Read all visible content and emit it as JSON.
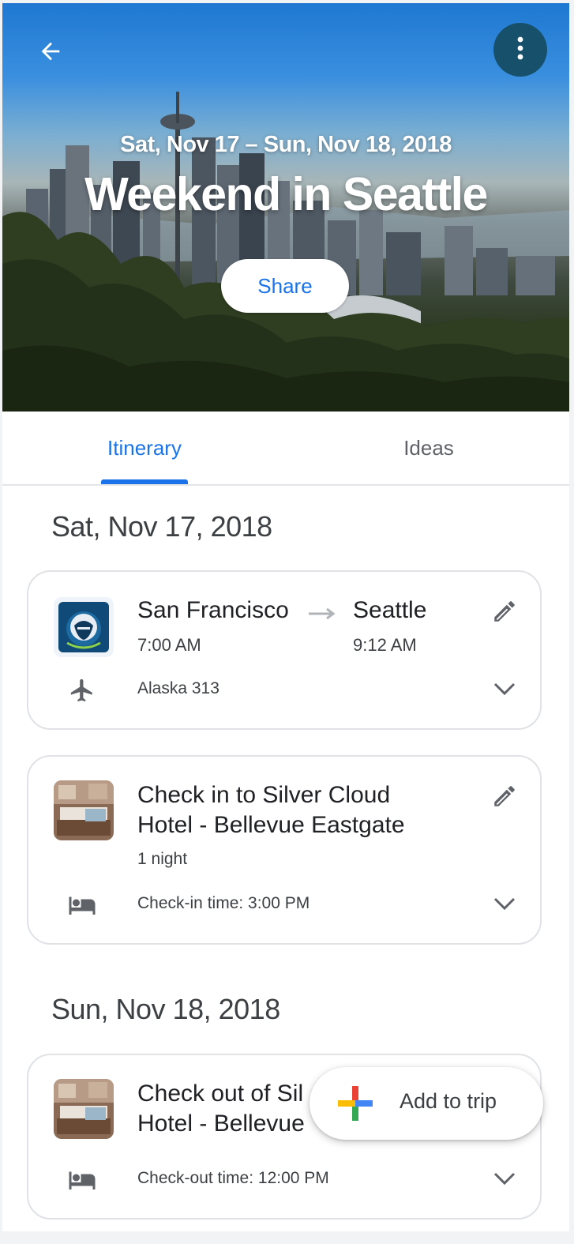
{
  "hero": {
    "dates": "Sat, Nov 17 – Sun, Nov 18, 2018",
    "title": "Weekend in Seattle",
    "share_label": "Share"
  },
  "tabs": [
    {
      "label": "Itinerary",
      "active": true
    },
    {
      "label": "Ideas",
      "active": false
    }
  ],
  "days": [
    {
      "heading": "Sat, Nov 17, 2018",
      "items": [
        {
          "type": "flight",
          "from_city": "San Francisco",
          "from_time": "7:00 AM",
          "to_city": "Seattle",
          "to_time": "9:12 AM",
          "detail": "Alaska 313",
          "icon": "airplane-icon"
        },
        {
          "type": "hotel",
          "title_line1": "Check in to Silver Cloud",
          "title_line2": "Hotel - Bellevue Eastgate",
          "subtitle": "1 night",
          "detail": "Check-in time: 3:00 PM",
          "icon": "bed-icon"
        }
      ]
    },
    {
      "heading": "Sun, Nov 18, 2018",
      "items": [
        {
          "type": "hotel",
          "title_line1": "Check out of Sil",
          "title_line2": "Hotel - Bellevue",
          "detail": "Check-out time: 12:00 PM",
          "icon": "bed-icon"
        }
      ]
    }
  ],
  "fab": {
    "label": "Add to trip"
  },
  "colors": {
    "accent": "#1a73e8",
    "menu_button": "#17506a",
    "plus_blue": "#4285f4",
    "plus_red": "#ea4335",
    "plus_yellow": "#fbbc04",
    "plus_green": "#34a853"
  }
}
